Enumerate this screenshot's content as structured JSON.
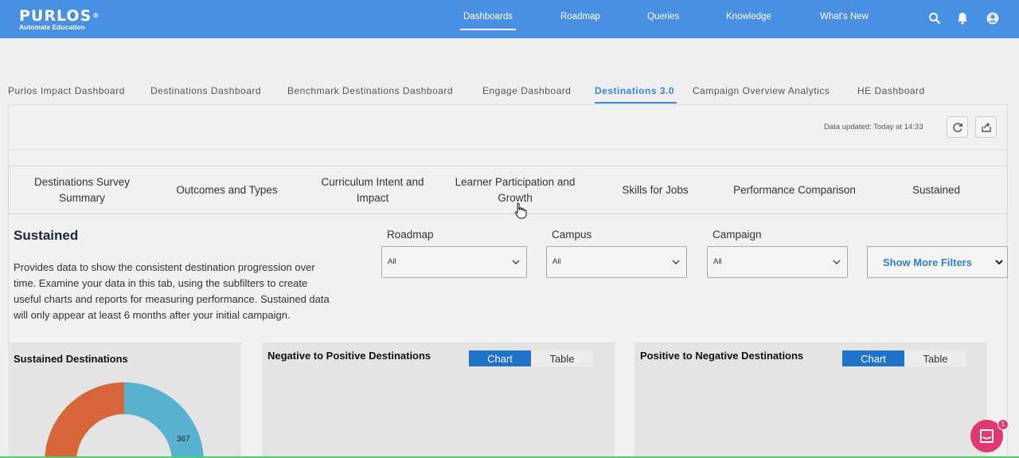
{
  "brand": {
    "name": "PURLOS",
    "mark": "®",
    "tagline": "Automate Education"
  },
  "topnav": {
    "items": [
      {
        "label": "Dashboards"
      },
      {
        "label": "Roadmap"
      },
      {
        "label": "Queries"
      },
      {
        "label": "Knowledge"
      },
      {
        "label": "What's New"
      }
    ],
    "active": "Dashboards"
  },
  "dashboard_tabs": [
    {
      "label": "Purlos Impact Dashboard"
    },
    {
      "label": "Destinations Dashboard"
    },
    {
      "label": "Benchmark Destinations Dashboard"
    },
    {
      "label": "Engage Dashboard"
    },
    {
      "label": "Destinations 3.0"
    },
    {
      "label": "Campaign Overview Analytics"
    },
    {
      "label": "HE Dashboard"
    }
  ],
  "data_updated": "Data updated: Today at 14:33",
  "sub_tabs": [
    {
      "line1": "Destinations Survey",
      "line2": "Summary"
    },
    {
      "line1": "Outcomes and Types",
      "line2": ""
    },
    {
      "line1": "Curriculum Intent and",
      "line2": "Impact"
    },
    {
      "line1": "Learner Participation and",
      "line2": "Growth"
    },
    {
      "line1": "Skills for Jobs",
      "line2": ""
    },
    {
      "line1": "Performance Comparison",
      "line2": ""
    },
    {
      "line1": "Sustained",
      "line2": ""
    }
  ],
  "section": {
    "title": "Sustained",
    "description": "Provides data to show the consistent destination progression over time. Examine your data in this tab, using the subfilters to create useful charts and reports for measuring performance. Sustained data will only appear at least 6 months after your initial campaign."
  },
  "filters": [
    {
      "label": "Roadmap",
      "value": "All"
    },
    {
      "label": "Campus",
      "value": "All"
    },
    {
      "label": "Campaign",
      "value": "All"
    }
  ],
  "more_filters_label": "Show More Filters",
  "cards": {
    "sustained": {
      "title": "Sustained Destinations",
      "donut_label": "367"
    },
    "neg_to_pos": {
      "title": "Negative to Positive Destinations",
      "chart": "Chart",
      "table": "Table"
    },
    "pos_to_neg": {
      "title": "Positive to Negative Destinations",
      "chart": "Chart",
      "table": "Table"
    }
  },
  "chat": {
    "badge": "1"
  },
  "colors": {
    "topbar": "#4a90e2",
    "accent": "#1f73c9",
    "donut_blue": "#58b1cf",
    "donut_orange": "#d9663a",
    "chat": "#e0396f"
  }
}
